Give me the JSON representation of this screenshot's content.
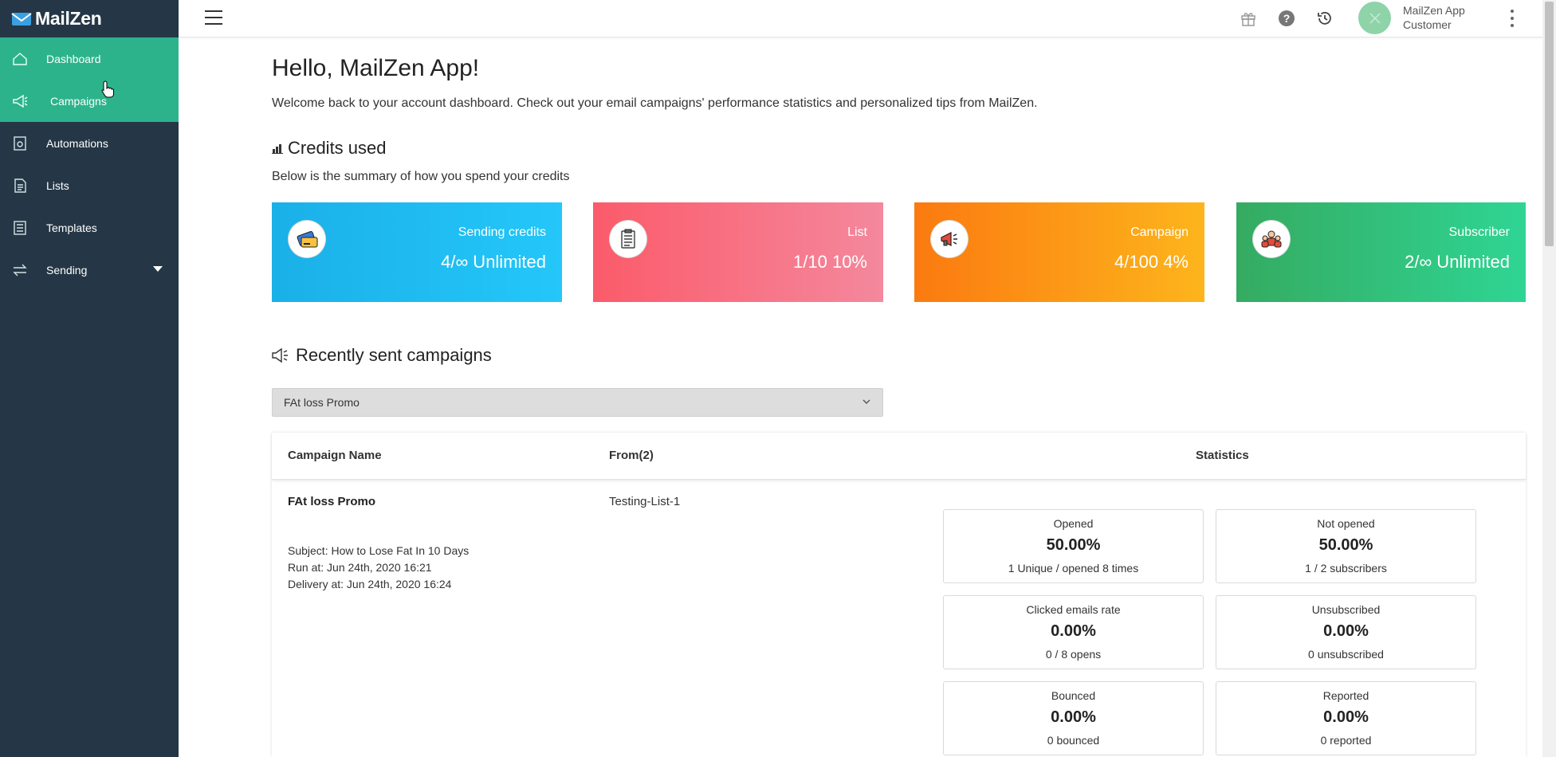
{
  "brand": {
    "name": "MailZen"
  },
  "sidebar": {
    "items": [
      {
        "label": "Dashboard",
        "icon": "home-icon"
      },
      {
        "label": "Campaigns",
        "icon": "megaphone-icon"
      },
      {
        "label": "Automations",
        "icon": "automation-icon"
      },
      {
        "label": "Lists",
        "icon": "list-icon"
      },
      {
        "label": "Templates",
        "icon": "template-icon"
      },
      {
        "label": "Sending",
        "icon": "sending-icon"
      }
    ]
  },
  "topbar": {
    "user_name": "MailZen App",
    "user_role": "Customer"
  },
  "main": {
    "greeting": "Hello, MailZen App!",
    "welcome": "Welcome back to your account dashboard. Check out your email campaigns' performance statistics and personalized tips from MailZen.",
    "credits_title": "Credits used",
    "credits_subtitle": "Below is the summary of how you spend your credits",
    "cards": [
      {
        "label": "Sending credits",
        "value": "4/∞ Unlimited",
        "color": "#1ab0e8",
        "icon": "credit-card-icon"
      },
      {
        "label": "List",
        "value": "1/10 10%",
        "color": "#fb5b6a",
        "icon": "clipboard-icon"
      },
      {
        "label": "Campaign",
        "value": "4/100 4%",
        "color": "#fb7a10",
        "icon": "megaphone-icon"
      },
      {
        "label": "Subscriber",
        "value": "2/∞ Unlimited",
        "color": "#35ab61",
        "icon": "subscribers-icon"
      }
    ],
    "recent_title": "Recently sent campaigns",
    "campaign_select": "FAt loss Promo",
    "table": {
      "headers": {
        "name": "Campaign Name",
        "from": "From(2)",
        "stats": "Statistics"
      },
      "row": {
        "name": "FAt loss Promo",
        "from": "Testing-List-1",
        "subject": "Subject: How to Lose Fat In 10 Days",
        "run_at": "Run at: Jun 24th, 2020 16:21",
        "delivery_at": "Delivery at: Jun 24th, 2020 16:24"
      },
      "stats": [
        {
          "label": "Opened",
          "value": "50.00%",
          "note": "1 Unique / opened 8 times"
        },
        {
          "label": "Not opened",
          "value": "50.00%",
          "note": "1 / 2 subscribers"
        },
        {
          "label": "Clicked emails rate",
          "value": "0.00%",
          "note": "0 / 8 opens"
        },
        {
          "label": "Unsubscribed",
          "value": "0.00%",
          "note": "0 unsubscribed"
        },
        {
          "label": "Bounced",
          "value": "0.00%",
          "note": "0 bounced"
        },
        {
          "label": "Reported",
          "value": "0.00%",
          "note": "0 reported"
        }
      ]
    }
  }
}
